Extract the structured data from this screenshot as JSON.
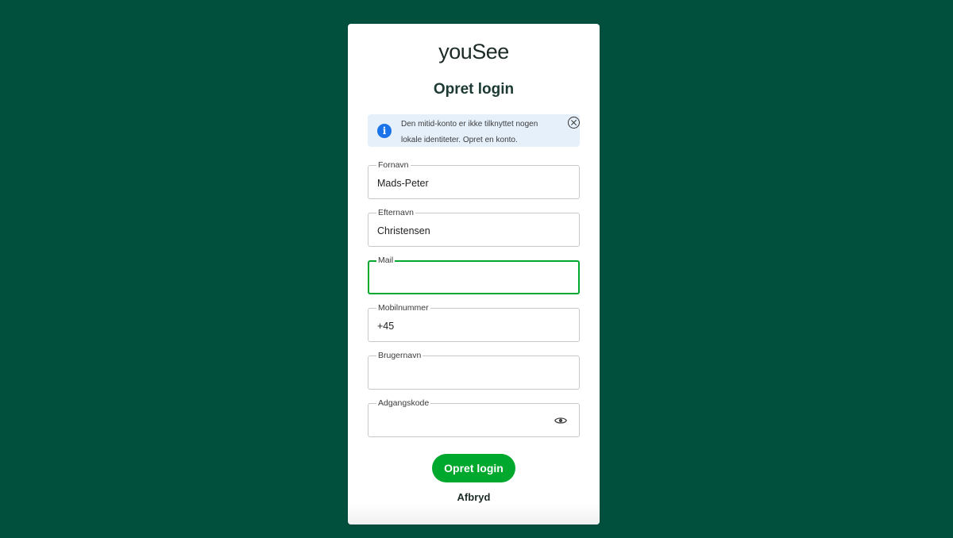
{
  "brand": {
    "logo_text": "youSee",
    "accent_color": "#00a82d",
    "background_color": "#00503d"
  },
  "page": {
    "title": "Opret login"
  },
  "info_banner": {
    "icon": "info-icon",
    "line1": "Den mitid-konto er ikke tilknyttet nogen",
    "line2": "lokale identiteter. Opret en konto.",
    "close_icon": "close-icon"
  },
  "form": {
    "first_name": {
      "label": "Fornavn",
      "value": "Mads-Peter"
    },
    "last_name": {
      "label": "Efternavn",
      "value": "Christensen"
    },
    "email": {
      "label": "Mail",
      "value": ""
    },
    "phone": {
      "label": "Mobilnummer",
      "value": "+45"
    },
    "username": {
      "label": "Brugernavn",
      "value": ""
    },
    "password": {
      "label": "Adgangskode",
      "value": "",
      "toggle_icon": "eye-icon"
    }
  },
  "actions": {
    "submit_label": "Opret login",
    "cancel_label": "Afbryd"
  }
}
